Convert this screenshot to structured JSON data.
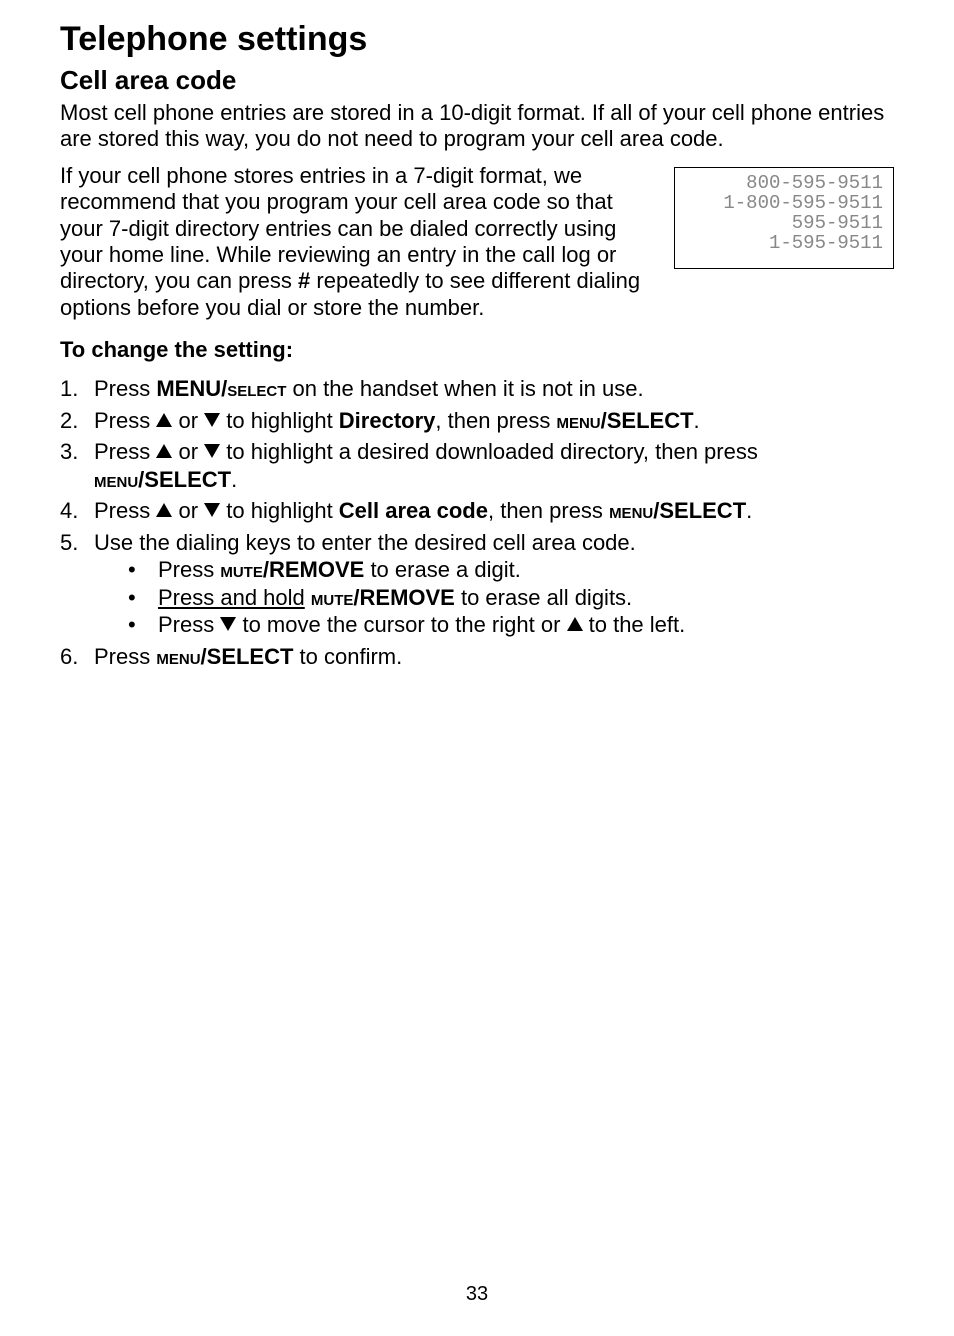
{
  "headings": {
    "main": "Telephone settings",
    "sub": "Cell area code",
    "change": "To change the setting:"
  },
  "intro_paragraph": "Most cell phone entries are stored in a 10-digit format. If all of your cell phone entries are stored this way, you do not need to program your cell area code.",
  "body_paragraph_before_hash": "If your cell phone stores entries in a 7-digit format, we recommend that you program your cell area code so that your 7-digit directory entries can be dialed correctly using your home line. While reviewing an entry in the call log or directory, you can press ",
  "body_paragraph_hash": "#",
  "body_paragraph_after_hash": " repeatedly to see different dialing options before you dial or store the number.",
  "display": {
    "l1": "800-595-9511",
    "l2": "1-800-595-9511",
    "l3": "595-9511",
    "l4": "1-595-9511"
  },
  "steps": {
    "s1_a": "Press ",
    "s1_b": "MENU/",
    "s1_c": "select",
    "s1_d": " on the handset when it is not in use.",
    "s2_a": "Press ",
    "s2_b": " or ",
    "s2_c": " to highlight ",
    "s2_d": "Directory",
    "s2_e": ", then press ",
    "s2_f": "menu",
    "s2_g": "/SELECT",
    "s2_h": ".",
    "s3_a": "Press ",
    "s3_b": " or ",
    "s3_c": " to highlight a desired downloaded directory, then press ",
    "s3_d": "menu",
    "s3_e": "/SELECT",
    "s3_f": ".",
    "s4_a": "Press ",
    "s4_b": " or ",
    "s4_c": " to highlight ",
    "s4_d": "Cell area code",
    "s4_e": ", then press ",
    "s4_f": "menu",
    "s4_g": "/SELECT",
    "s4_h": ".",
    "s5": "Use the dialing keys to enter the desired cell area code.",
    "s5b1_a": "Press ",
    "s5b1_b": "mute",
    "s5b1_c": "/REMOVE",
    "s5b1_d": " to erase a digit.",
    "s5b2_a": "Press and hold",
    "s5b2_b": " ",
    "s5b2_c": "mute",
    "s5b2_d": "/REMOVE",
    "s5b2_e": " to erase all digits.",
    "s5b3_a": "Press ",
    "s5b3_b": " to move the cursor to the right or ",
    "s5b3_c": " to the left.",
    "s6_a": "Press ",
    "s6_b": "menu",
    "s6_c": "/SELECT",
    "s6_d": " to confirm."
  },
  "page_number": "33"
}
